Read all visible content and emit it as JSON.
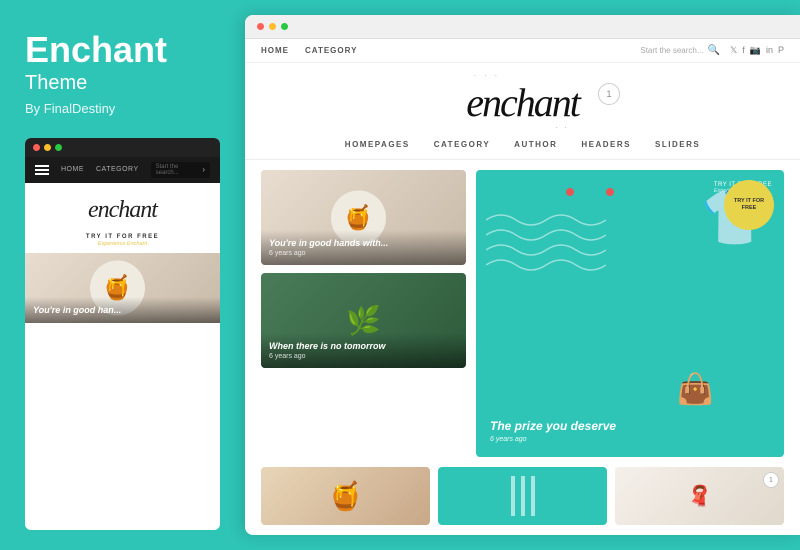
{
  "left": {
    "brand_title": "Enchant",
    "brand_subtitle": "Theme",
    "brand_author": "By FinalDestiny",
    "preview": {
      "nav_items": [
        "HOME",
        "CATEGORY"
      ],
      "search_placeholder": "Start the search...",
      "logo_text": "enchant",
      "cta_main": "TRY IT FOR FREE",
      "cta_sub": "Experience Enchant",
      "image_caption": "You're in good han..."
    }
  },
  "right": {
    "browser_dots": [
      "red",
      "yellow",
      "green"
    ],
    "nav": {
      "links": [
        "HOME",
        "CATEGORY"
      ],
      "search_label": "Start the search...",
      "social_icons": [
        "twitter",
        "facebook",
        "instagram",
        "linkedin",
        "pinterest"
      ]
    },
    "hero": {
      "logo_text": "enchant",
      "badge": "1"
    },
    "second_nav": {
      "links": [
        "HOMEPAGES",
        "CATEGORY",
        "AUTHOR",
        "HEADERS",
        "SLIDERS"
      ]
    },
    "posts": [
      {
        "title": "You're in good hands with...",
        "date": "6 years ago",
        "type": "food"
      },
      {
        "title": "When there is no tomorrow",
        "date": "6 years ago",
        "type": "plant"
      }
    ],
    "featured": {
      "try_label": "TRY IT FOR FREE",
      "title": "The prize you deserve",
      "subtitle": "6 years ago",
      "badge_line1": "TRY IT FOR",
      "badge_line2": "FREE",
      "badge_sub": "Experience Enchant"
    },
    "bottom": {
      "card3_badge": "1"
    }
  }
}
